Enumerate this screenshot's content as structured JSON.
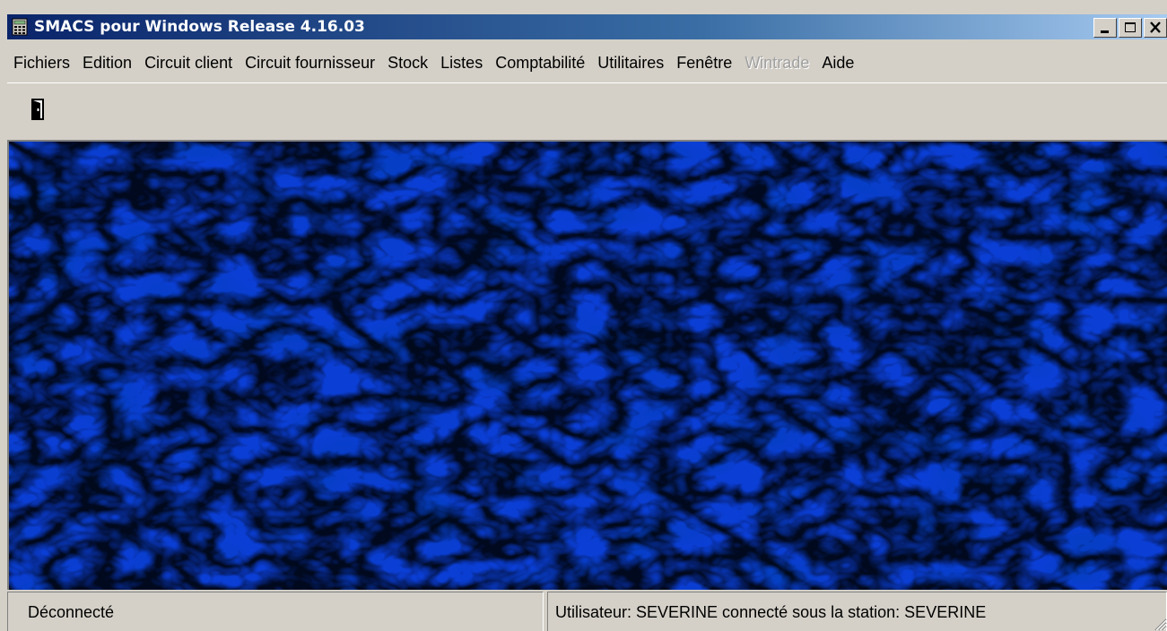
{
  "window": {
    "title": "SMACS pour Windows Release 4.16.03",
    "app_icon": "calculator-icon",
    "controls": {
      "minimize_icon": "minimize-icon",
      "maximize_icon": "maximize-icon",
      "close_icon": "close-icon"
    }
  },
  "menu": {
    "items": [
      {
        "label": "Fichiers",
        "enabled": true
      },
      {
        "label": "Edition",
        "enabled": true
      },
      {
        "label": "Circuit client",
        "enabled": true
      },
      {
        "label": "Circuit fournisseur",
        "enabled": true
      },
      {
        "label": "Stock",
        "enabled": true
      },
      {
        "label": "Listes",
        "enabled": true
      },
      {
        "label": "Comptabilité",
        "enabled": true
      },
      {
        "label": "Utilitaires",
        "enabled": true
      },
      {
        "label": "Fenêtre",
        "enabled": true
      },
      {
        "label": "Wintrade",
        "enabled": false
      },
      {
        "label": "Aide",
        "enabled": true
      }
    ]
  },
  "toolbar": {
    "exit_icon": "door-exit-icon"
  },
  "client_area": {
    "background": "blue-texture",
    "colors": {
      "base": "#0b3ed4",
      "dark": "#0420a8",
      "light": "#3fa0ff"
    }
  },
  "statusbar": {
    "connection_status": "Déconnecté",
    "user_info": "Utilisateur: SEVERINE connecté sous la station: SEVERINE"
  }
}
